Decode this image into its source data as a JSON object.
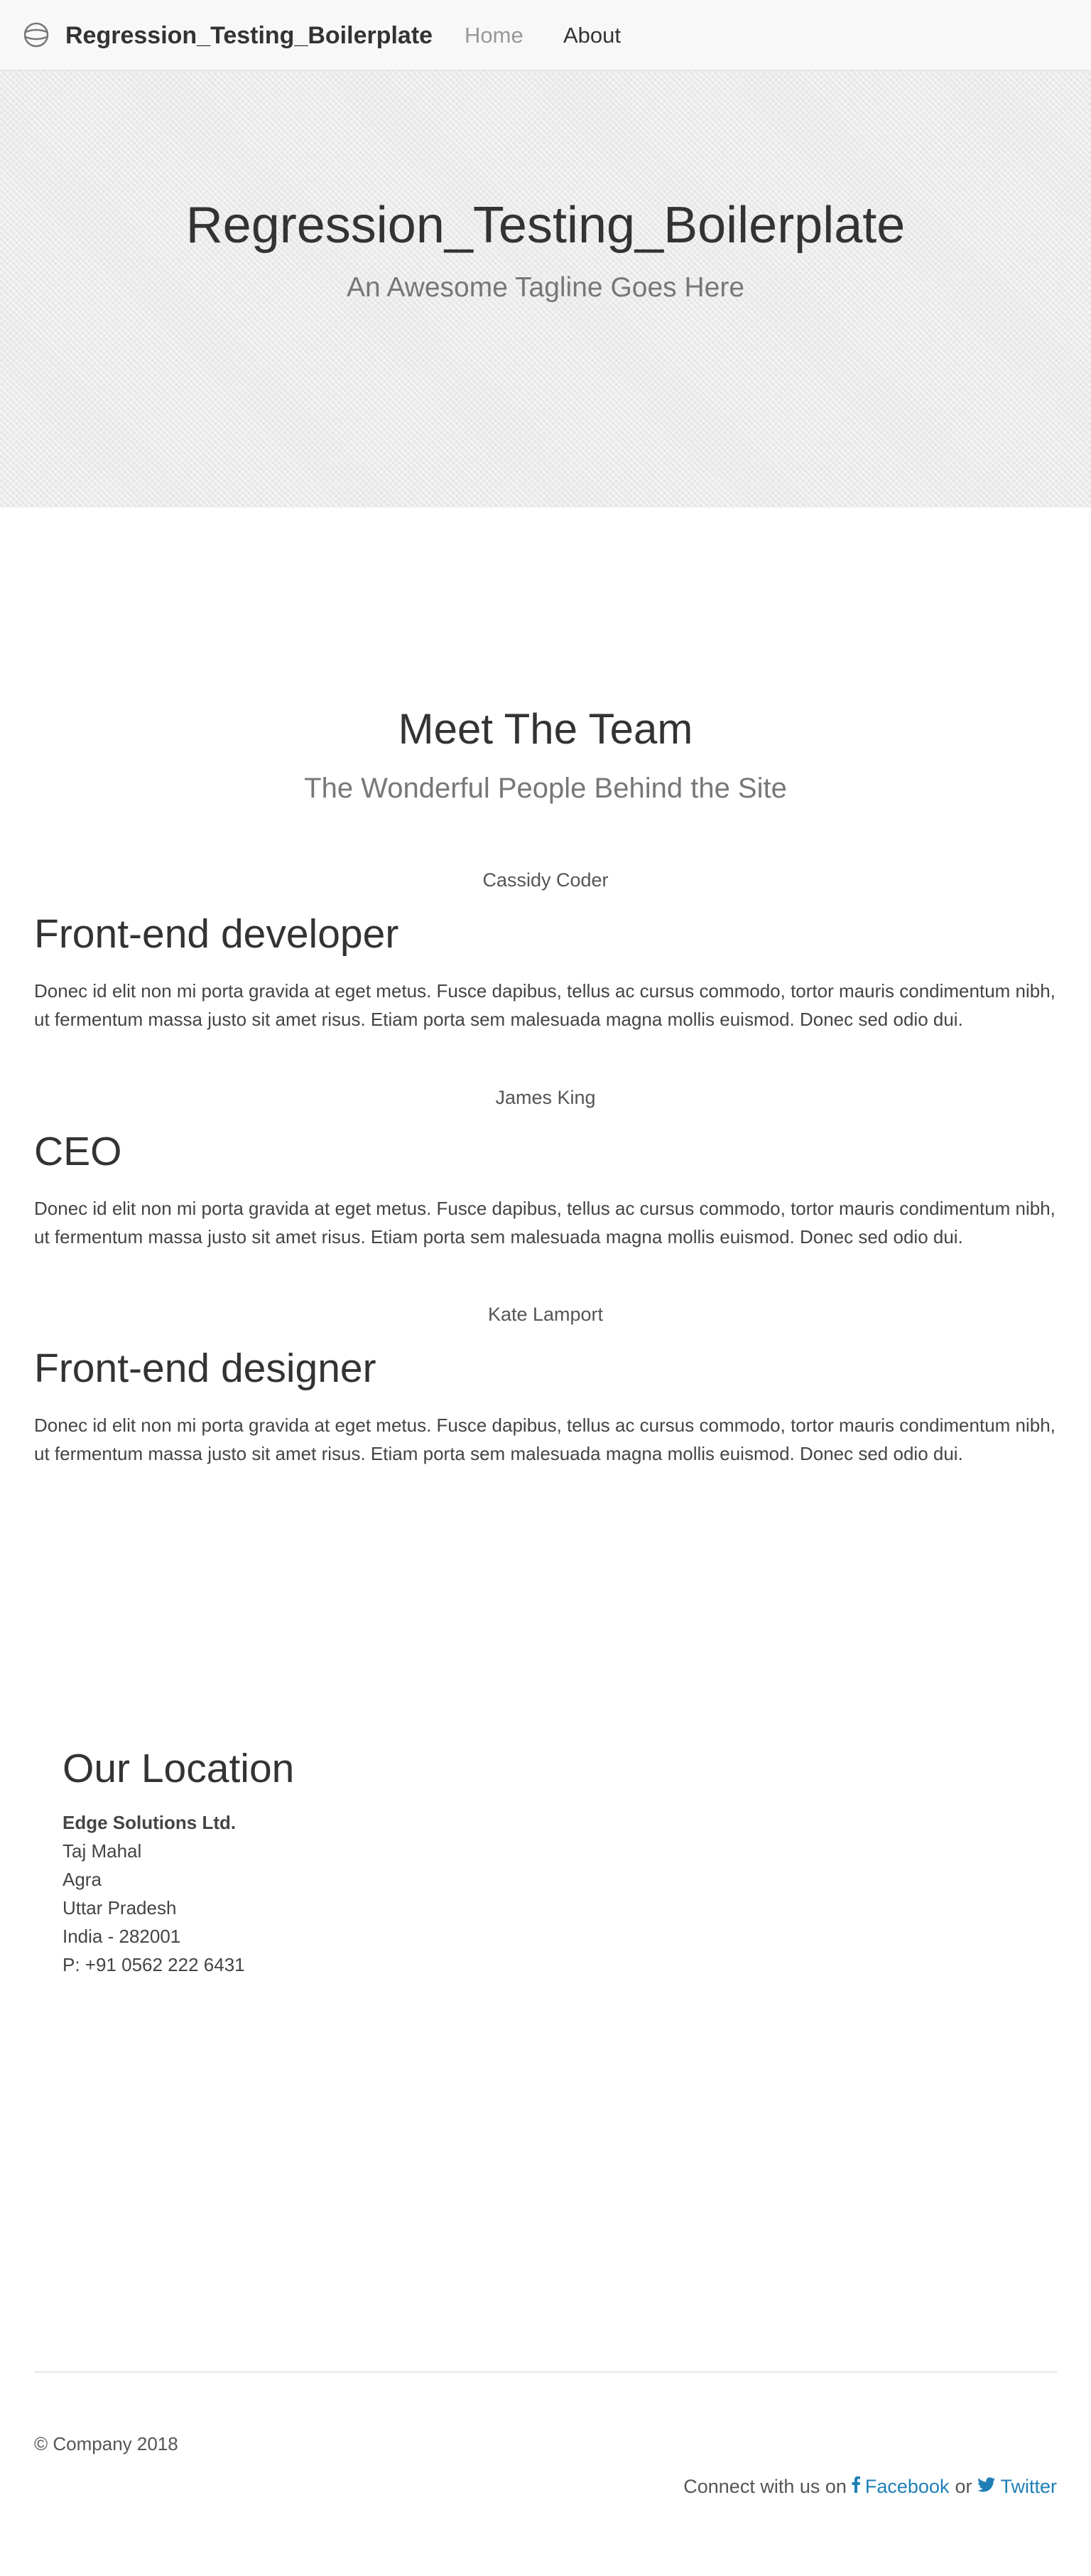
{
  "navbar": {
    "brand": "Regression_Testing_Boilerplate",
    "brand_icon": "globe-icon",
    "links": [
      {
        "label": "Home",
        "active": true
      },
      {
        "label": "About",
        "active": false
      }
    ]
  },
  "hero": {
    "title": "Regression_Testing_Boilerplate",
    "tagline": "An Awesome Tagline Goes Here"
  },
  "team": {
    "heading": "Meet The Team",
    "subheading": "The Wonderful People Behind the Site",
    "members": [
      {
        "name": "Cassidy Coder",
        "role": "Front-end developer",
        "bio": "Donec id elit non mi porta gravida at eget metus. Fusce dapibus, tellus ac cursus commodo, tortor mauris condimentum nibh, ut fermentum massa justo sit amet risus. Etiam porta sem malesuada magna mollis euismod. Donec sed odio dui."
      },
      {
        "name": "James King",
        "role": "CEO",
        "bio": "Donec id elit non mi porta gravida at eget metus. Fusce dapibus, tellus ac cursus commodo, tortor mauris condimentum nibh, ut fermentum massa justo sit amet risus. Etiam porta sem malesuada magna mollis euismod. Donec sed odio dui."
      },
      {
        "name": "Kate Lamport",
        "role": "Front-end designer",
        "bio": "Donec id elit non mi porta gravida at eget metus. Fusce dapibus, tellus ac cursus commodo, tortor mauris condimentum nibh, ut fermentum massa justo sit amet risus. Etiam porta sem malesuada magna mollis euismod. Donec sed odio dui."
      }
    ]
  },
  "location": {
    "title": "Our Location",
    "company": "Edge Solutions Ltd.",
    "lines": [
      "Taj Mahal",
      "Agra",
      "Uttar Pradesh",
      "India - 282001",
      "P: +91 0562 222 6431"
    ]
  },
  "footer": {
    "copyright": "© Company 2018",
    "connect_prefix": "Connect with us on",
    "connect_or": "or",
    "facebook_label": "Facebook",
    "facebook_icon": "facebook-icon",
    "twitter_label": "Twitter",
    "twitter_icon": "twitter-icon",
    "link_color": "#1f7fb5"
  }
}
